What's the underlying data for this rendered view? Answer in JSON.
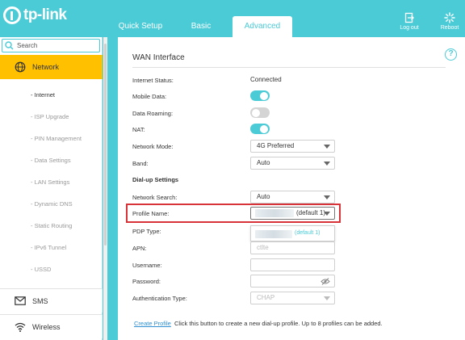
{
  "brand": {
    "logo_text": "tp-link"
  },
  "top_tabs": {
    "quick_setup": "Quick Setup",
    "basic": "Basic",
    "advanced": "Advanced"
  },
  "header_buttons": {
    "logout": "Log out",
    "reboot": "Reboot"
  },
  "sidebar": {
    "search_placeholder": "Search",
    "network": "Network",
    "network_items": [
      "- Internet",
      "- ISP Upgrade",
      "- PIN Management",
      "- Data Settings",
      "- LAN Settings",
      "- Dynamic DNS",
      "- Static Routing",
      "- IPv6 Tunnel",
      "- USSD"
    ],
    "sms": "SMS",
    "wireless": "Wireless"
  },
  "main": {
    "title": "WAN Interface",
    "help_glyph": "?",
    "internet_status_label": "Internet Status:",
    "internet_status_value": "Connected",
    "mobile_data_label": "Mobile Data:",
    "data_roaming_label": "Data Roaming:",
    "nat_label": "NAT:",
    "network_mode_label": "Network Mode:",
    "network_mode_value": "4G Preferred",
    "band_label": "Band:",
    "band_value": "Auto",
    "dialup_heading": "Dial-up Settings",
    "network_search_label": "Network Search:",
    "network_search_value": "Auto",
    "profile_name_label": "Profile Name:",
    "profile_name_suffix": "(default 1)",
    "dropdown_option_suffix": "(default 1)",
    "pdp_type_label": "PDP Type:",
    "apn_label": "APN:",
    "apn_value": "ctlte",
    "username_label": "Username:",
    "password_label": "Password:",
    "auth_type_label": "Authentication Type:",
    "auth_type_value": "CHAP",
    "create_profile_link": "Create Profile",
    "create_profile_note": "Click this button to create a new dial-up profile. Up to 8 profiles can be added."
  },
  "toggles": {
    "mobile_data": true,
    "data_roaming": false,
    "nat": true
  },
  "colors": {
    "accent": "#4acbd6",
    "active_nav": "#ffc000",
    "highlight_border": "#d9333a",
    "link": "#2f8fd0"
  }
}
